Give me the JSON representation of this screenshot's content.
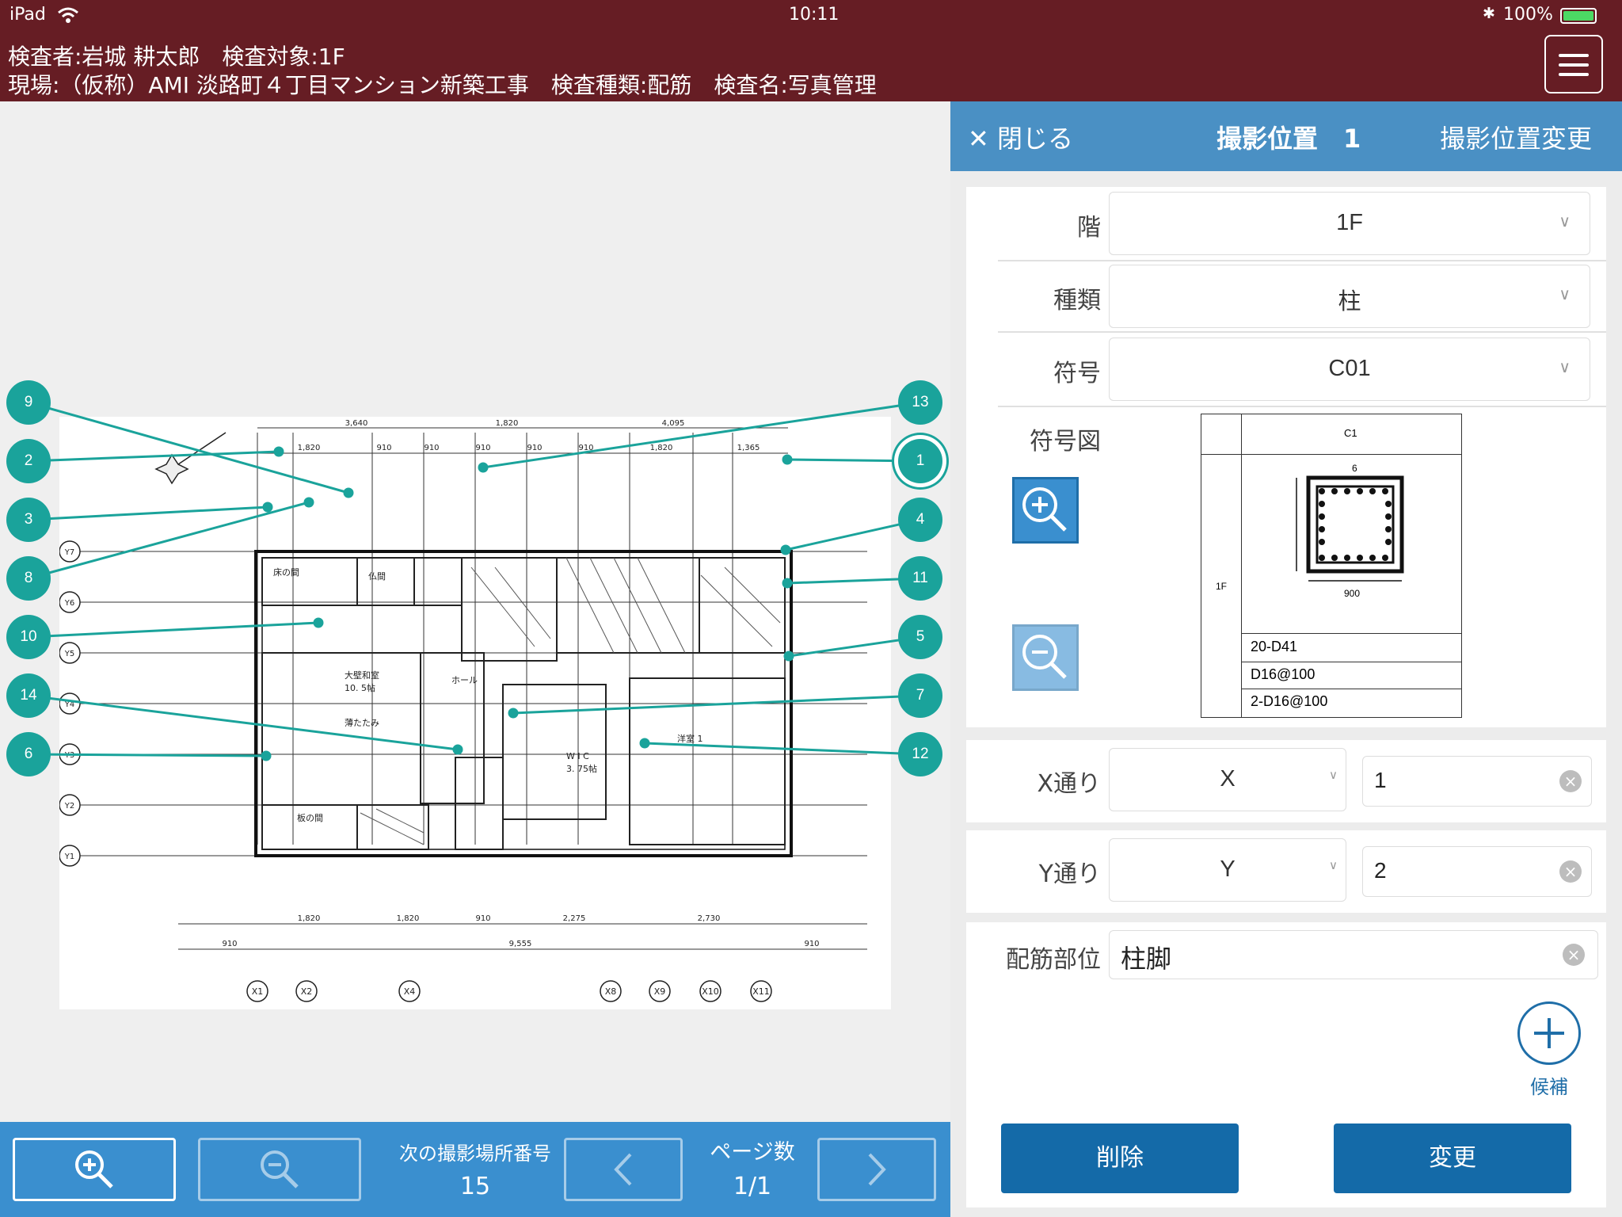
{
  "status_bar": {
    "device": "iPad",
    "time": "10:11",
    "battery": "100%"
  },
  "header": {
    "line1": "検査者:岩城 耕太郎　検査対象:1F",
    "line2": "現場:（仮称）AMI 淡路町４丁目マンション新築工事　検査種類:配筋　検査名:写真管理",
    "menu_icon": "hamburger-icon"
  },
  "drawing": {
    "markers": [
      "9",
      "2",
      "3",
      "8",
      "10",
      "14",
      "6",
      "13",
      "1",
      "4",
      "11",
      "5",
      "7",
      "12"
    ],
    "selected_marker": "1",
    "dimensions_top": [
      "3,640",
      "1,820",
      "4,095",
      "1,820",
      "910",
      "910",
      "910",
      "910",
      "910",
      "1,820",
      "1,365"
    ],
    "dimensions_bottom": [
      "1,820",
      "1,820",
      "910",
      "2,275",
      "2,730",
      "910",
      "9,555",
      "910"
    ],
    "axes_x": [
      "X1",
      "X2",
      "X4",
      "X8",
      "X9",
      "X10",
      "X11"
    ],
    "axes_y": [
      "Y7",
      "Y6",
      "Y5",
      "Y4",
      "Y3",
      "Y2",
      "Y1"
    ]
  },
  "toolbar": {
    "next_label": "次の撮影場所番号",
    "next_value": "15",
    "page_label": "ページ数",
    "page_value": "1/1"
  },
  "panel": {
    "close_label": "閉じる",
    "title": "撮影位置　1",
    "change_label": "撮影位置変更",
    "floor_label": "階",
    "floor_value": "1F",
    "type_label": "種類",
    "type_value": "柱",
    "code_label": "符号",
    "code_value": "C01",
    "code_figure_label": "符号図",
    "figure": {
      "code": "C1",
      "floor": "1F",
      "rebar1": "20-D41",
      "rebar2": "D16@100",
      "rebar3": "2-D16@100",
      "dim_a": "6",
      "dim_b": "900"
    },
    "x_label": "X通り",
    "x_prefix": "X",
    "x_value": "1",
    "y_label": "Y通り",
    "y_prefix": "Y",
    "y_value": "2",
    "part_label": "配筋部位",
    "part_value": "柱脚",
    "candidate_label": "候補",
    "delete_label": "削除",
    "change_button": "変更"
  }
}
